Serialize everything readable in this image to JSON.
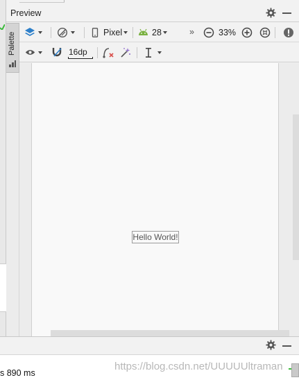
{
  "panel": {
    "title": "Preview"
  },
  "sidebar": {
    "palette_label": "Palette"
  },
  "toolbar_primary": {
    "device_label": "Pixel",
    "api_level_label": "28",
    "zoom_label": "33%",
    "overflow_label": "»"
  },
  "toolbar_secondary": {
    "margin_value": "16dp"
  },
  "canvas": {
    "text_view_label": "Hello World!"
  },
  "bottom_panel": {
    "status_text": "s 890 ms",
    "watermark": "https://blog.csdn.net/UUUUUltraman"
  },
  "colors": {
    "android_green": "#79b040",
    "layers_blue": "#2d7fc9",
    "error_red": "#d9534f",
    "magic_purple": "#8a66c9",
    "icon_gray": "#555555"
  }
}
